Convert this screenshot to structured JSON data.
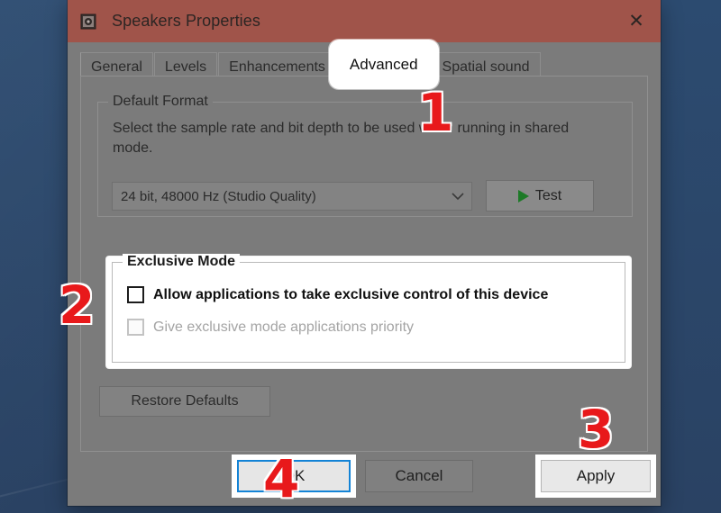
{
  "window": {
    "title": "Speakers Properties",
    "icon": "speaker-icon",
    "close_label": "✕",
    "titlebar_color": "#a0544a"
  },
  "tabs": [
    {
      "label": "General",
      "active": false
    },
    {
      "label": "Levels",
      "active": false
    },
    {
      "label": "Enhancements",
      "active": false
    },
    {
      "label": "Advanced",
      "active": true
    },
    {
      "label": "Spatial sound",
      "active": false
    }
  ],
  "default_format": {
    "group_title": "Default Format",
    "description": "Select the sample rate and bit depth to be used when running in shared mode.",
    "combo_value": "24 bit, 48000 Hz (Studio Quality)",
    "combo_arrow": "⌄",
    "test_button": "Test",
    "play_icon": "play-triangle-icon",
    "play_icon_color": "#1d7a27"
  },
  "exclusive_mode": {
    "group_title": "Exclusive Mode",
    "checkbox_allow": {
      "label": "Allow applications to take exclusive control of this device",
      "checked": false,
      "enabled": true
    },
    "checkbox_priority": {
      "label": "Give exclusive mode applications priority",
      "checked": false,
      "enabled": false
    }
  },
  "restore_defaults_button": "Restore Defaults",
  "footer": {
    "ok_label": "OK",
    "cancel_label": "Cancel",
    "apply_label": "Apply"
  },
  "annotations": {
    "one": "1",
    "two": "2",
    "three": "3",
    "four": "4",
    "color": "#e8191b"
  }
}
